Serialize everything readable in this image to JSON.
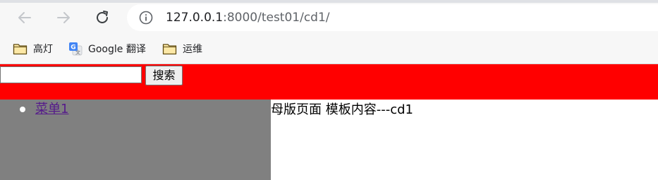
{
  "browser": {
    "url_host": "127.0.0.1",
    "url_rest": ":8000/test01/cd1/"
  },
  "bookmarks": [
    {
      "label": "高灯",
      "icon": "folder-icon"
    },
    {
      "label": "Google 翻译",
      "icon": "google-translate-icon"
    },
    {
      "label": "运维",
      "icon": "folder-icon"
    }
  ],
  "header": {
    "search_value": "",
    "search_button_label": "搜索",
    "background_color": "#ff0000"
  },
  "menu": {
    "items": [
      {
        "label": "菜单1"
      }
    ],
    "background_color": "#808080"
  },
  "main": {
    "content_text": "母版页面 模板内容---cd1"
  }
}
